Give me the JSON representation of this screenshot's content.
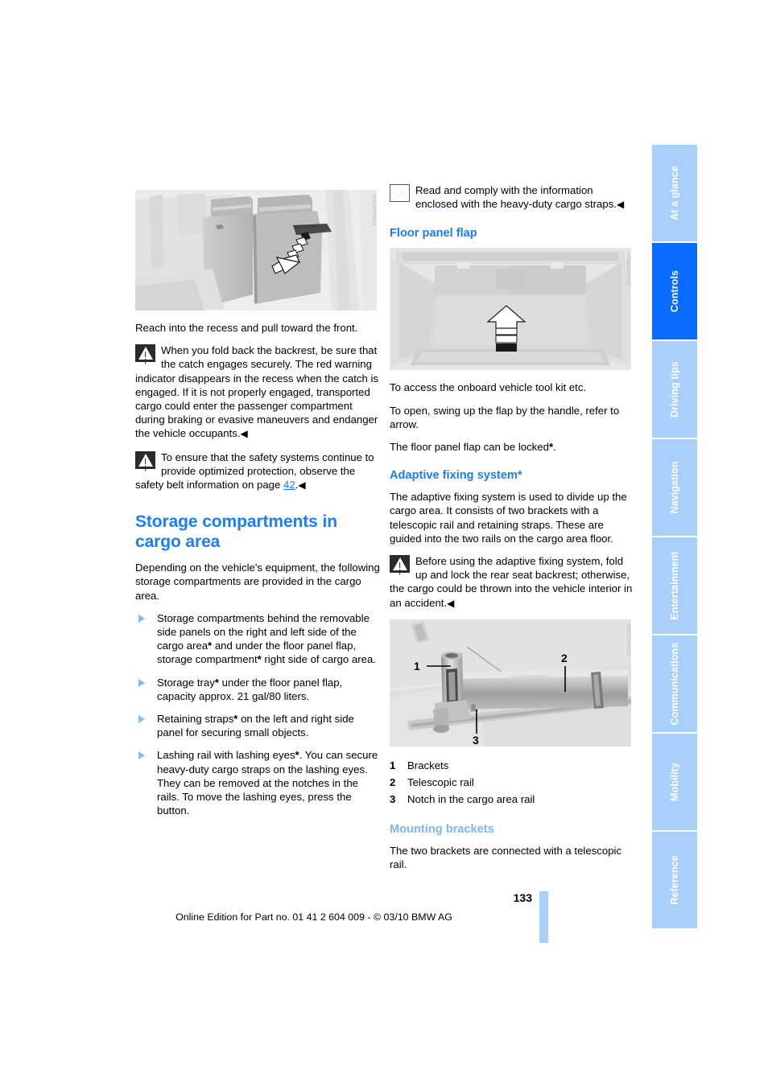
{
  "page": {
    "number": "133",
    "footer_note": "Online Edition for Part no. 01 41 2 604 009 - © 03/10 BMW AG"
  },
  "tabs": [
    {
      "label": "At a glance",
      "active": false
    },
    {
      "label": "Controls",
      "active": true
    },
    {
      "label": "Driving tips",
      "active": false
    },
    {
      "label": "Navigation",
      "active": false
    },
    {
      "label": "Entertainment",
      "active": false
    },
    {
      "label": "Communications",
      "active": false
    },
    {
      "label": "Mobility",
      "active": false
    },
    {
      "label": "Reference",
      "active": false
    }
  ],
  "colors": {
    "heading_blue": "#1a7cff",
    "subheading_light_blue": "#7fb5fb",
    "tab_inactive": "#a9cffb",
    "tab_active": "#0a6bff"
  },
  "left_column": {
    "figure_rear_seat": {
      "caption_watermark": "W5ND0D0101",
      "alt": "Rear seat backrest with arrow pointing forward to recess"
    },
    "intro": "Reach into the recess and pull toward the front.",
    "warning_1": "When you fold back the backrest, be sure that the catch engages securely. The red warning indicator disappears in the recess when the catch is engaged. If it is not properly engaged, transported cargo could enter the passenger compartment during braking or evasive maneuvers and endanger the vehicle occupants.",
    "warning_2_before": "To ensure that the safety systems continue to provide optimized protection, observe the safety belt information on page ",
    "warning_2_page": "42",
    "warning_2_after": ".",
    "section_title": "Storage compartments in cargo area",
    "section_intro": "Depending on the vehicle's equipment, the following storage compartments are provided in the cargo area.",
    "bullets": [
      "Storage compartments behind the removable side panels on the right and left side of the cargo area* and under the floor panel flap, storage compartment* right side of cargo area.",
      "Storage tray* under the floor panel flap, capacity approx. 21 gal/80 liters.",
      "Retaining straps* on the left and right side panel for securing small objects.",
      "Lashing rail with lashing eyes*. You can secure heavy-duty cargo straps on the lashing eyes.\nThey can be removed at the notches in the rails. To move the lashing eyes, press the button."
    ]
  },
  "right_column": {
    "note_cargo_straps": "Read and comply with the information enclosed with the heavy-duty cargo straps.",
    "floor_panel_flap": {
      "heading": "Floor panel flap",
      "figure_watermark": "W5D03040005",
      "figure_alt": "Cargo area with upward arrow at floor panel flap handle",
      "para_1": "To access the onboard vehicle tool kit etc.",
      "para_2": "To open, swing up the flap by the handle, refer to arrow.",
      "para_3": "The floor panel flap can be locked*."
    },
    "adaptive_fixing_system": {
      "heading": "Adaptive fixing system*",
      "para_1": "The adaptive fixing system is used to divide up the cargo area. It consists of two brackets with a telescopic rail and retaining straps. These are guided into the two rails on the cargo area floor.",
      "warning": "Before using the adaptive fixing system, fold up and lock the rear seat backrest; otherwise, the cargo could be thrown into the vehicle interior in an accident.",
      "figure_watermark": "W5C03040005",
      "figure_alt": "Close-up of bracket, telescopic rail and notch in the cargo area rail",
      "legend": [
        {
          "num": "1",
          "text": "Brackets"
        },
        {
          "num": "2",
          "text": "Telescopic rail"
        },
        {
          "num": "3",
          "text": "Notch in the cargo area rail"
        }
      ]
    },
    "mounting_brackets": {
      "heading": "Mounting brackets",
      "para_1": "The two brackets are connected with a telescopic rail."
    }
  }
}
